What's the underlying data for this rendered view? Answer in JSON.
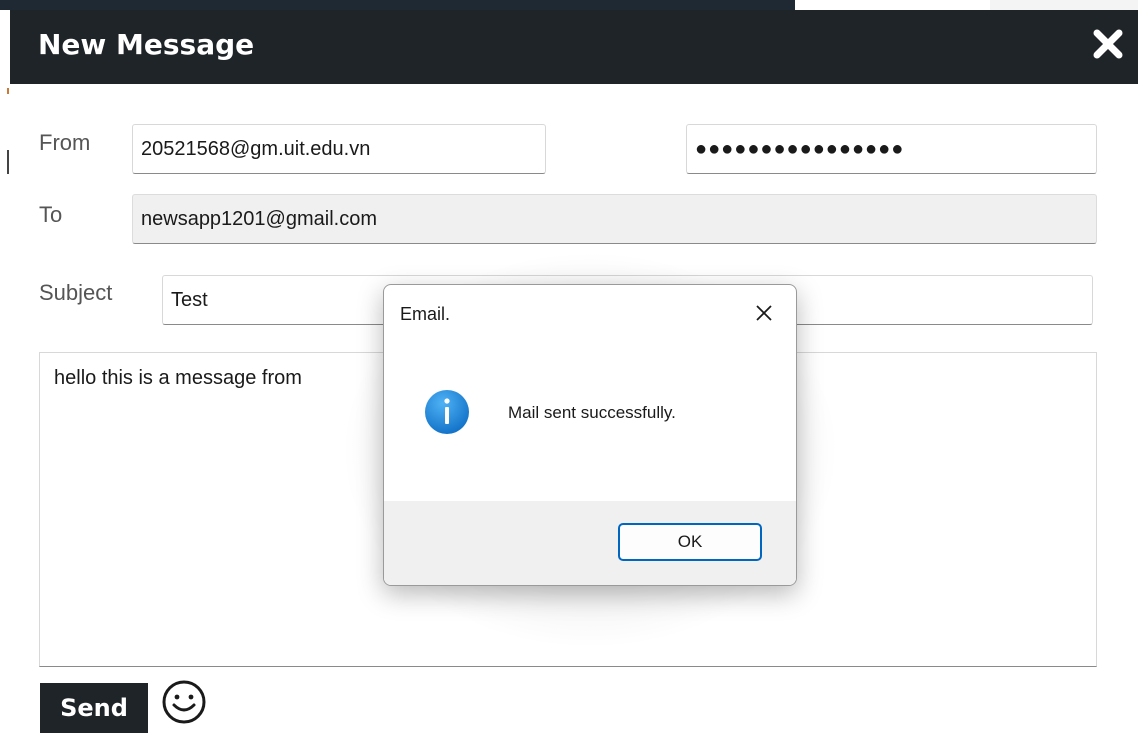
{
  "window": {
    "title": "New Message",
    "close_icon": "close-icon"
  },
  "form": {
    "from_label": "From",
    "from_value": "20521568@gm.uit.edu.vn",
    "password_value": "●●●●●●●●●●●●●●●●",
    "to_label": "To",
    "to_value": "newsapp1201@gmail.com",
    "subject_label": "Subject",
    "subject_value": "Test",
    "body_value": "hello this is a message from"
  },
  "actions": {
    "send_label": "Send",
    "emoji_icon": "smiley-icon"
  },
  "dialog": {
    "title": "Email.",
    "message": "Mail sent successfully.",
    "ok_label": "OK",
    "icon": "info-icon",
    "close_icon": "close-icon"
  },
  "colors": {
    "titlebar": "#1f2428",
    "accent": "#0067c0",
    "info_icon": "#1a8ae0"
  }
}
